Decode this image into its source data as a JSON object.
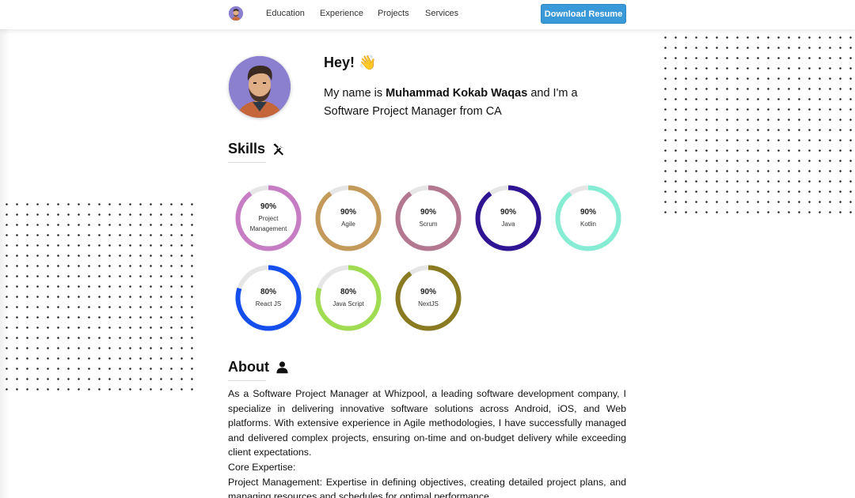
{
  "nav": {
    "links": [
      "Education",
      "Experience",
      "Projects",
      "Services"
    ],
    "download_label": "Download Resume"
  },
  "intro": {
    "greeting": "Hey!",
    "greeting_emoji": "👋",
    "line_prefix": "My name is ",
    "name": "Muhammad Kokab Waqas",
    "line_suffix": " and I'm a Software Project Manager from CA"
  },
  "skills": {
    "title": "Skills",
    "icon": "tools-icon",
    "items": [
      {
        "label": "Project Management",
        "percent": 90,
        "percent_text": "90%",
        "color": "#c77dc4"
      },
      {
        "label": "Agile",
        "percent": 90,
        "percent_text": "90%",
        "color": "#c49a5a"
      },
      {
        "label": "Scrum",
        "percent": 90,
        "percent_text": "90%",
        "color": "#b3778f"
      },
      {
        "label": "Java",
        "percent": 90,
        "percent_text": "90%",
        "color": "#2f1494"
      },
      {
        "label": "Kotlin",
        "percent": 90,
        "percent_text": "90%",
        "color": "#86ecd3"
      },
      {
        "label": "React JS",
        "percent": 80,
        "percent_text": "80%",
        "color": "#1550ef"
      },
      {
        "label": "Java Script",
        "percent": 80,
        "percent_text": "80%",
        "color": "#9fdc52"
      },
      {
        "label": "NextJS",
        "percent": 90,
        "percent_text": "90%",
        "color": "#8a7a22"
      }
    ]
  },
  "about": {
    "title": "About",
    "icon": "user-icon",
    "paragraph": "As a Software Project Manager at Whizpool, a leading software development company, I specialize in delivering innovative software solutions across Android, iOS, and Web platforms. With extensive experience in Agile methodologies, I have successfully managed and delivered complex projects, ensuring on-time and on-budget delivery while exceeding client expectations.",
    "core_heading": "Core Expertise:",
    "core_item": "Project Management: Expertise in defining objectives, creating detailed project plans, and managing resources and schedules for optimal performance."
  },
  "colors": {
    "accent_button": "#3a99d8",
    "ring_track": "#e6e6e6"
  }
}
